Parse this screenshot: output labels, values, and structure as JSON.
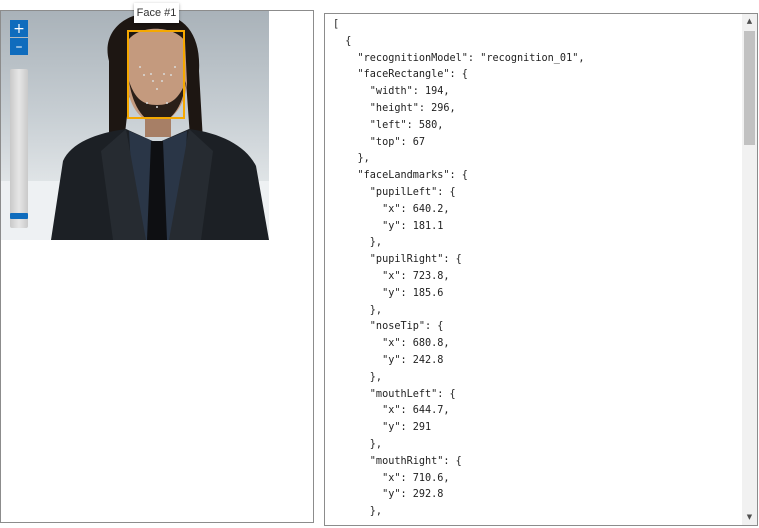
{
  "viewer": {
    "zoom_in_label": "+",
    "zoom_out_label": "–",
    "zoom_level": 0.05,
    "face_label": "Face #1",
    "box_color": "#f5a800",
    "accent_color": "#0f6cbd"
  },
  "json_panel": {
    "lines": [
      "[",
      "  {",
      "    \"recognitionModel\": \"recognition_01\",",
      "    \"faceRectangle\": {",
      "      \"width\": 194,",
      "      \"height\": 296,",
      "      \"left\": 580,",
      "      \"top\": 67",
      "    },",
      "    \"faceLandmarks\": {",
      "      \"pupilLeft\": {",
      "        \"x\": 640.2,",
      "        \"y\": 181.1",
      "      },",
      "      \"pupilRight\": {",
      "        \"x\": 723.8,",
      "        \"y\": 185.6",
      "      },",
      "      \"noseTip\": {",
      "        \"x\": 680.8,",
      "        \"y\": 242.8",
      "      },",
      "      \"mouthLeft\": {",
      "        \"x\": 644.7,",
      "        \"y\": 291",
      "      },",
      "      \"mouthRight\": {",
      "        \"x\": 710.6,",
      "        \"y\": 292.8",
      "      },"
    ]
  }
}
